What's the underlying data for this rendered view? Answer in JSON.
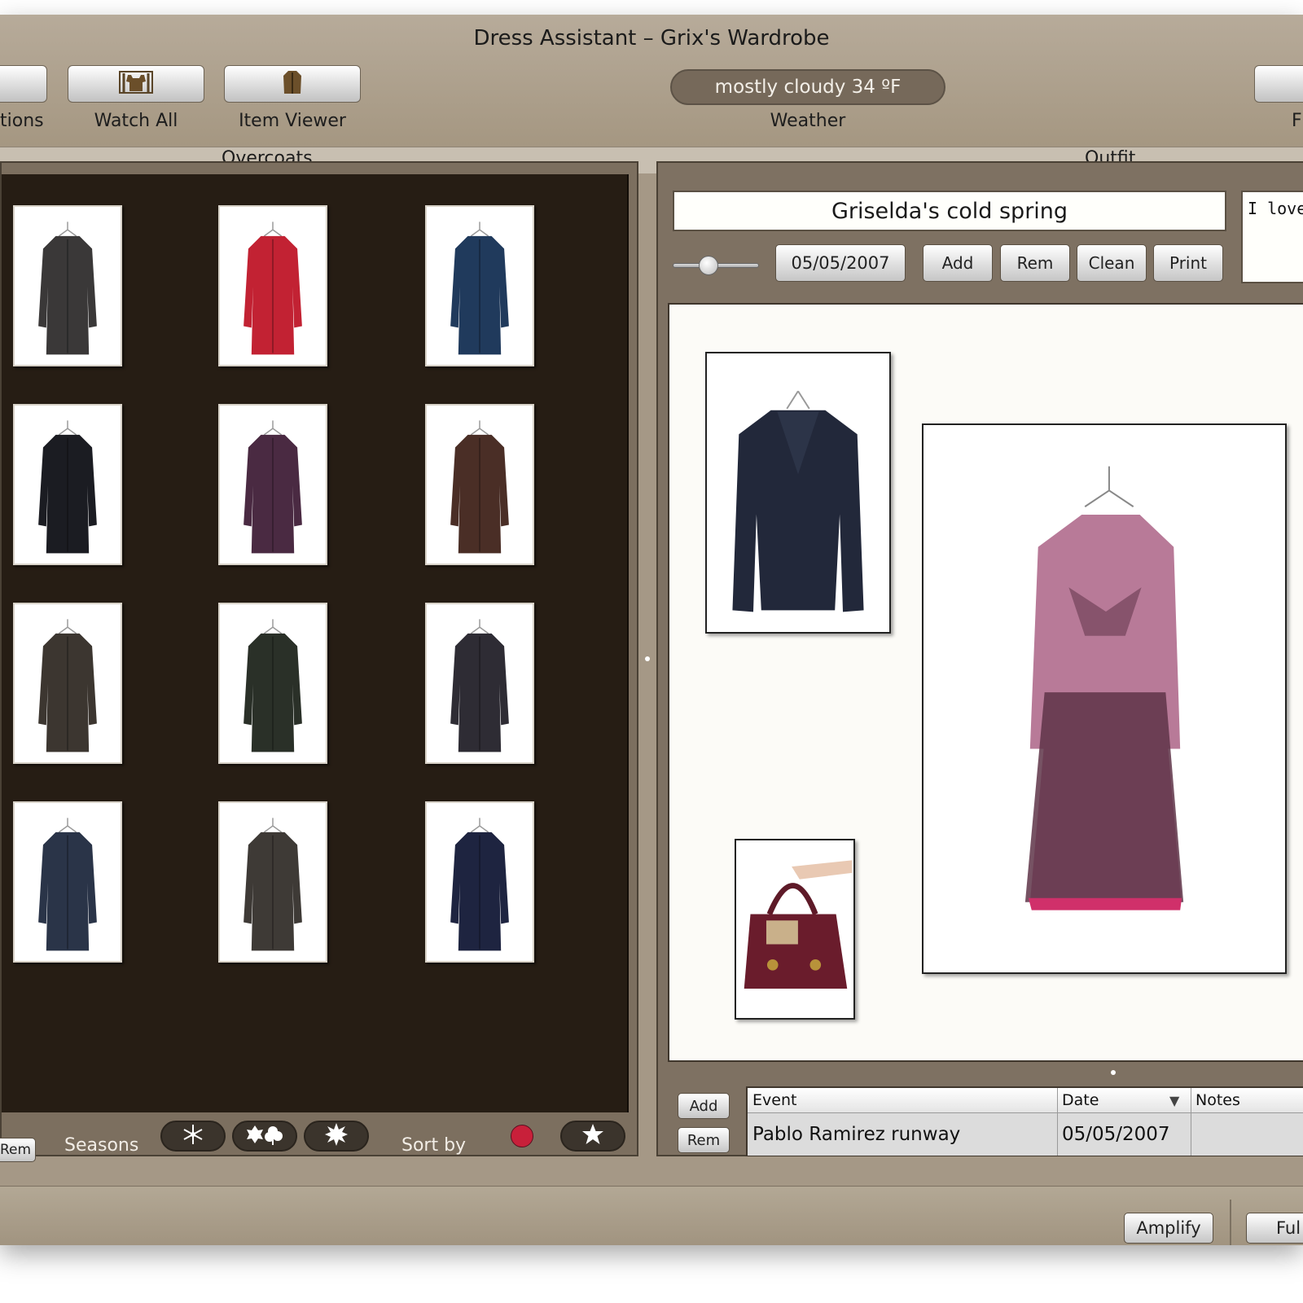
{
  "window": {
    "title": "Dress Assistant – Grix's Wardrobe"
  },
  "toolbar": {
    "options_label": "tions",
    "watch_all_label": "Watch All",
    "item_viewer_label": "Item Viewer",
    "weather_value": "mostly cloudy 34 ºF",
    "weather_label": "Weather",
    "right_label": "F"
  },
  "sections": {
    "left_title": "Overcoats",
    "right_title": "Outfit"
  },
  "overcoats": {
    "items": [
      {
        "name": "dark-grey-coat",
        "color": "#3a3838"
      },
      {
        "name": "red-jacket-skirt",
        "color": "#c22233"
      },
      {
        "name": "blue-long-coat",
        "color": "#203a5c"
      },
      {
        "name": "black-long-coat",
        "color": "#1b1c22"
      },
      {
        "name": "purple-coat",
        "color": "#4a2a42"
      },
      {
        "name": "brown-belted-coat",
        "color": "#4a2e26"
      },
      {
        "name": "brown-trench-coat",
        "color": "#3c3630"
      },
      {
        "name": "green-hooded-coat",
        "color": "#2a3028"
      },
      {
        "name": "charcoal-hooded-coat",
        "color": "#2e2c34"
      },
      {
        "name": "denim-long-coat",
        "color": "#2a3448"
      },
      {
        "name": "grey-wool-coat",
        "color": "#3e3a36"
      },
      {
        "name": "navy-peacoat",
        "color": "#1e2440"
      }
    ]
  },
  "left_footer": {
    "rem_label": "Rem",
    "seasons_label": "Seasons",
    "sort_by_label": "Sort by"
  },
  "outfit": {
    "name": "Griselda's cold spring",
    "date": "05/05/2007",
    "slider_value": 0.4,
    "add_label": "Add",
    "rem_label": "Rem",
    "clean_label": "Clean",
    "print_label": "Print",
    "notes_text": "I love"
  },
  "events": {
    "add_label": "Add",
    "rem_label": "Rem",
    "columns": [
      "Event",
      "Date",
      "Notes"
    ],
    "rows": [
      {
        "event": "Pablo Ramirez runway",
        "date": "05/05/2007",
        "notes": ""
      }
    ]
  },
  "bottom": {
    "amplify_label": "Amplify",
    "full_label": "Ful"
  },
  "colors": {
    "window_bg": "#a59886",
    "grid_bg": "#261d14",
    "sort_dot": "#c8203a"
  }
}
